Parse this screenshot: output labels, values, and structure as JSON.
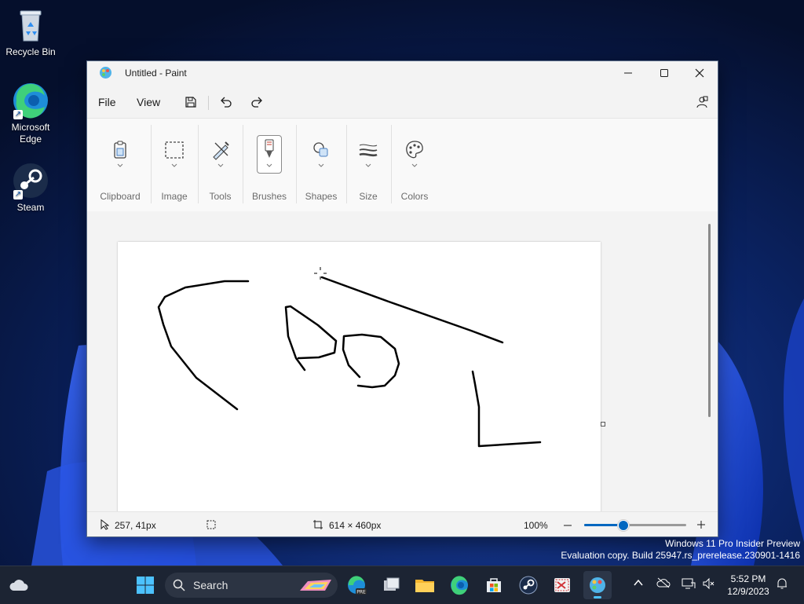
{
  "desktop": {
    "icons": [
      {
        "label": "Recycle Bin",
        "icon": "recycle-bin-icon"
      },
      {
        "label": "Microsoft Edge",
        "icon": "edge-icon"
      },
      {
        "label": "Steam",
        "icon": "steam-icon"
      }
    ]
  },
  "window": {
    "title": "Untitled - Paint",
    "controls": {
      "minimize": "minimize-icon",
      "maximize": "maximize-icon",
      "close": "close-icon"
    }
  },
  "menubar": {
    "file_label": "File",
    "view_label": "View",
    "quick_actions": [
      "save-icon",
      "undo-icon",
      "redo-icon"
    ],
    "account_icon": "account-settings-icon"
  },
  "ribbon": {
    "groups": [
      {
        "label": "Clipboard",
        "icon": "clipboard-icon"
      },
      {
        "label": "Image",
        "icon": "select-rectangle-icon"
      },
      {
        "label": "Tools",
        "icon": "tools-icon"
      },
      {
        "label": "Brushes",
        "icon": "brush-icon",
        "selected": true
      },
      {
        "label": "Shapes",
        "icon": "shapes-icon"
      },
      {
        "label": "Size",
        "icon": "stroke-size-icon"
      },
      {
        "label": "Colors",
        "icon": "palette-icon"
      }
    ]
  },
  "statusbar": {
    "cursor_position": "257, 41px",
    "canvas_size": "614 × 460px",
    "zoom": "100%",
    "zoom_slider_fraction": 0.38
  },
  "watermark": {
    "line1": "Windows 11 Pro Insider Preview",
    "line2": "Evaluation copy. Build 25947.rs_prerelease.230901-1416"
  },
  "taskbar": {
    "search_label": "Search",
    "apps": [
      "start-icon",
      "edge-beta-icon",
      "task-view-icon",
      "file-explorer-icon",
      "edge-icon",
      "store-icon",
      "steam-icon",
      "snipping-tool-icon",
      "paint-icon"
    ],
    "active_app": "paint-icon",
    "tray_icons": [
      "chevron-up-icon",
      "onedrive-icon",
      "network-icon",
      "volume-muted-icon",
      "notification-icon"
    ],
    "time": "5:52 PM",
    "date": "12/9/2023"
  },
  "colors": {
    "accent": "#0067c0",
    "taskbar": "#1c2433",
    "window_bg": "#f3f3f3"
  }
}
